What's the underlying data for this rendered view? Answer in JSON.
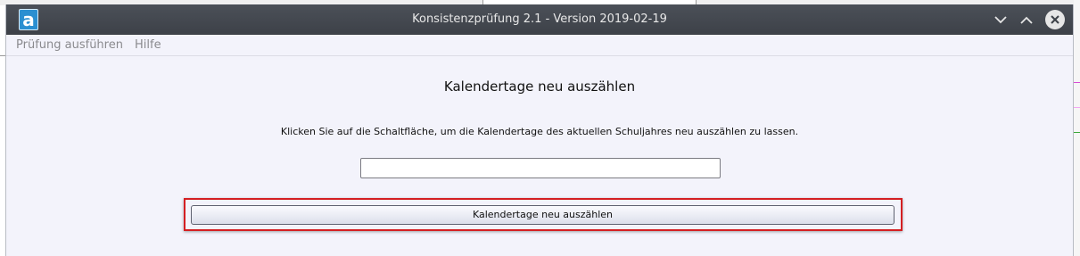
{
  "window": {
    "title": "Konsistenzprüfung 2.1 - Version 2019-02-19",
    "app_icon_letter": "a",
    "controls": [
      "minimize-icon",
      "maximize-icon",
      "close-icon"
    ]
  },
  "menubar": {
    "items": [
      {
        "label": "Prüfung ausführen"
      },
      {
        "label": "Hilfe"
      }
    ]
  },
  "main": {
    "heading": "Kalendertage neu auszählen",
    "description": "Klicken Sie auf die Schaltfläche, um die Kalendertage des aktuellen Schuljahres neu auszählen zu lassen.",
    "status_field": {
      "value": "",
      "placeholder": ""
    },
    "button_label": "Kalendertage neu auszählen"
  },
  "colors": {
    "titlebar": "#42464d",
    "window_bg": "#f3f3fb",
    "highlight": "#d41f22",
    "app_icon": "#2b8fd1"
  }
}
